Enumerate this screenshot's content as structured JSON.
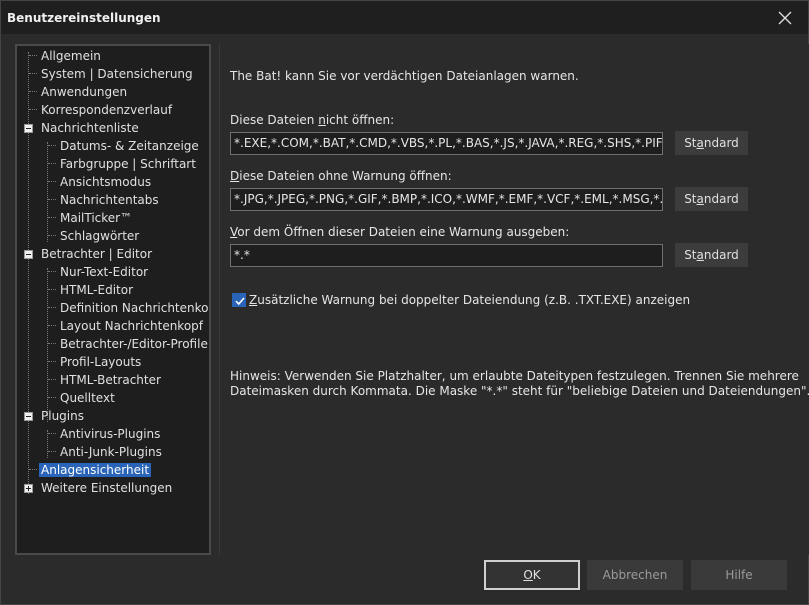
{
  "window": {
    "title": "Benutzereinstellungen"
  },
  "tree": {
    "items": [
      {
        "label": "Allgemein"
      },
      {
        "label": "System | Datensicherung"
      },
      {
        "label": "Anwendungen"
      },
      {
        "label": "Korrespondenzverlauf"
      },
      {
        "label": "Nachrichtenliste"
      },
      {
        "label": "Datums- & Zeitanzeige"
      },
      {
        "label": "Farbgruppe | Schriftart"
      },
      {
        "label": "Ansichtsmodus"
      },
      {
        "label": "Nachrichtentabs"
      },
      {
        "label": "MailTicker™"
      },
      {
        "label": "Schlagwörter"
      },
      {
        "label": "Betrachter | Editor"
      },
      {
        "label": "Nur-Text-Editor"
      },
      {
        "label": "HTML-Editor"
      },
      {
        "label": "Definition Nachrichtenkopf"
      },
      {
        "label": "Layout Nachrichtenkopf"
      },
      {
        "label": "Betrachter-/Editor-Profile"
      },
      {
        "label": "Profil-Layouts"
      },
      {
        "label": "HTML-Betrachter"
      },
      {
        "label": "Quelltext"
      },
      {
        "label": "Plugins"
      },
      {
        "label": "Antivirus-Plugins"
      },
      {
        "label": "Anti-Junk-Plugins"
      },
      {
        "label": "Anlagensicherheit"
      },
      {
        "label": "Weitere Einstellungen"
      }
    ]
  },
  "panel": {
    "intro": "The Bat! kann Sie vor verdächtigen Dateianlagen warnen.",
    "block_label": {
      "pre": "Diese Dateien ",
      "accel": "n",
      "post": "icht öffnen:"
    },
    "block_value": "*.EXE,*.COM,*.BAT,*.CMD,*.VBS,*.PL,*.BAS,*.JS,*.JAVA,*.REG,*.SHS,*.PIF,*.SCR,*.DLL",
    "nowarn_label": {
      "pre": "",
      "accel": "D",
      "post": "iese Dateien ohne Warnung öffnen:"
    },
    "nowarn_value": "*.JPG,*.JPEG,*.PNG,*.GIF,*.BMP,*.ICO,*.WMF,*.EMF,*.VCF,*.EML,*.MSG,*.ARJ,*.ZIP,*.RAR",
    "warn_label": {
      "pre": "",
      "accel": "V",
      "post": "or dem Öffnen dieser Dateien eine Warnung ausgeben:"
    },
    "warn_value": "*.*",
    "standard_label": {
      "pre": "St",
      "accel": "a",
      "post": "ndard"
    },
    "checkbox": {
      "pre": "",
      "accel": "Z",
      "post": "usätzliche Warnung bei doppelter Dateiendung (z.B. .TXT.EXE) anzeigen",
      "checked": true
    },
    "hint_line1": "Hinweis: Verwenden Sie Platzhalter, um erlaubte Dateitypen festzulegen. Trennen Sie mehrere",
    "hint_line2": "Dateimasken durch Kommata. Die Maske \"*.*\" steht für \"beliebige Dateien und Dateiendungen\"."
  },
  "footer": {
    "ok": {
      "pre": "",
      "accel": "O",
      "post": "K"
    },
    "cancel": "Abbrechen",
    "help": "Hilfe"
  },
  "colors": {
    "selection": "#2a64b8",
    "background": "#2b2b2b",
    "titlebar": "#1f1f1f"
  }
}
